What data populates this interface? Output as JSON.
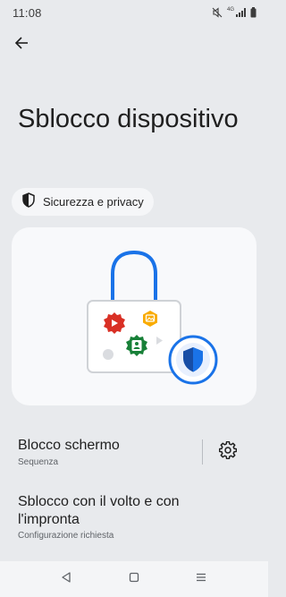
{
  "status_bar": {
    "time": "11:08",
    "network": "4G",
    "icons": [
      "mute-icon",
      "signal-icon",
      "battery-icon"
    ]
  },
  "header": {
    "back_icon": "arrow-back-icon"
  },
  "page": {
    "title": "Sblocco dispositivo"
  },
  "chip": {
    "icon": "shield-icon",
    "label": "Sicurezza e privacy"
  },
  "illustration": {
    "icon": "padlock-illustration"
  },
  "settings": [
    {
      "title": "Blocco schermo",
      "subtitle": "Sequenza",
      "action_icon": "gear-icon"
    },
    {
      "title": "Sblocco con il volto e con l'impronta",
      "subtitle": "Configurazione richiesta"
    }
  ],
  "nav_bar": {
    "icons": [
      "nav-back-icon",
      "nav-home-icon",
      "nav-recents-icon"
    ]
  },
  "colors": {
    "background": "#e8eaed",
    "card": "#f8f9fb",
    "accent_blue": "#1a73e8",
    "text_primary": "#1f1f1f",
    "text_secondary": "#5f6368"
  }
}
